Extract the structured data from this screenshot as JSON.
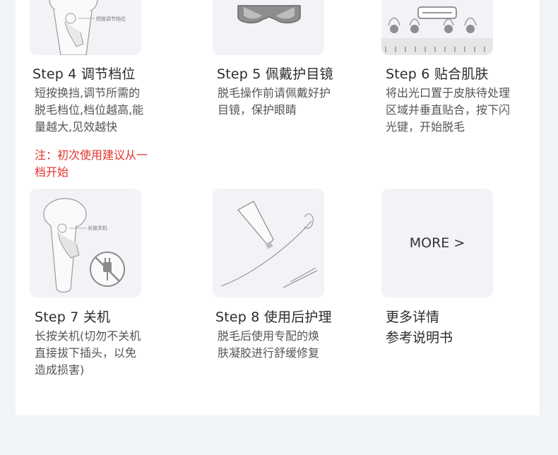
{
  "steps": [
    {
      "title": "Step 4 调节档位",
      "desc_lines": [
        "短按换挡,调节所需的",
        "脱毛档位,档位越高,能",
        "量越大,见效越快"
      ],
      "note_lines": [
        "注：初次使用建议从一",
        "档开始"
      ],
      "image_label": "短按调节档位"
    },
    {
      "title": "Step 5 佩戴护目镜",
      "desc_lines": [
        "脱毛操作前请佩戴好护",
        "目镜，保护眼睛"
      ]
    },
    {
      "title": "Step 6 贴合肌肤",
      "desc_lines": [
        "将出光口置于皮肤待处理",
        "区域并垂直贴合，按下闪",
        "光键，开始脱毛"
      ]
    },
    {
      "title": "Step 7 关机",
      "desc_lines": [
        "长按关机(切勿不关机",
        "直接拔下插头，以免",
        "造成损害)"
      ],
      "image_label": "长按关机"
    },
    {
      "title": "Step 8 使用后护理",
      "desc_lines": [
        "脱毛后使用专配的焕",
        "肤凝胶进行舒缓修复"
      ]
    }
  ],
  "more": {
    "label": "MORE >",
    "line1": "更多详情",
    "line2": "参考说明书"
  }
}
